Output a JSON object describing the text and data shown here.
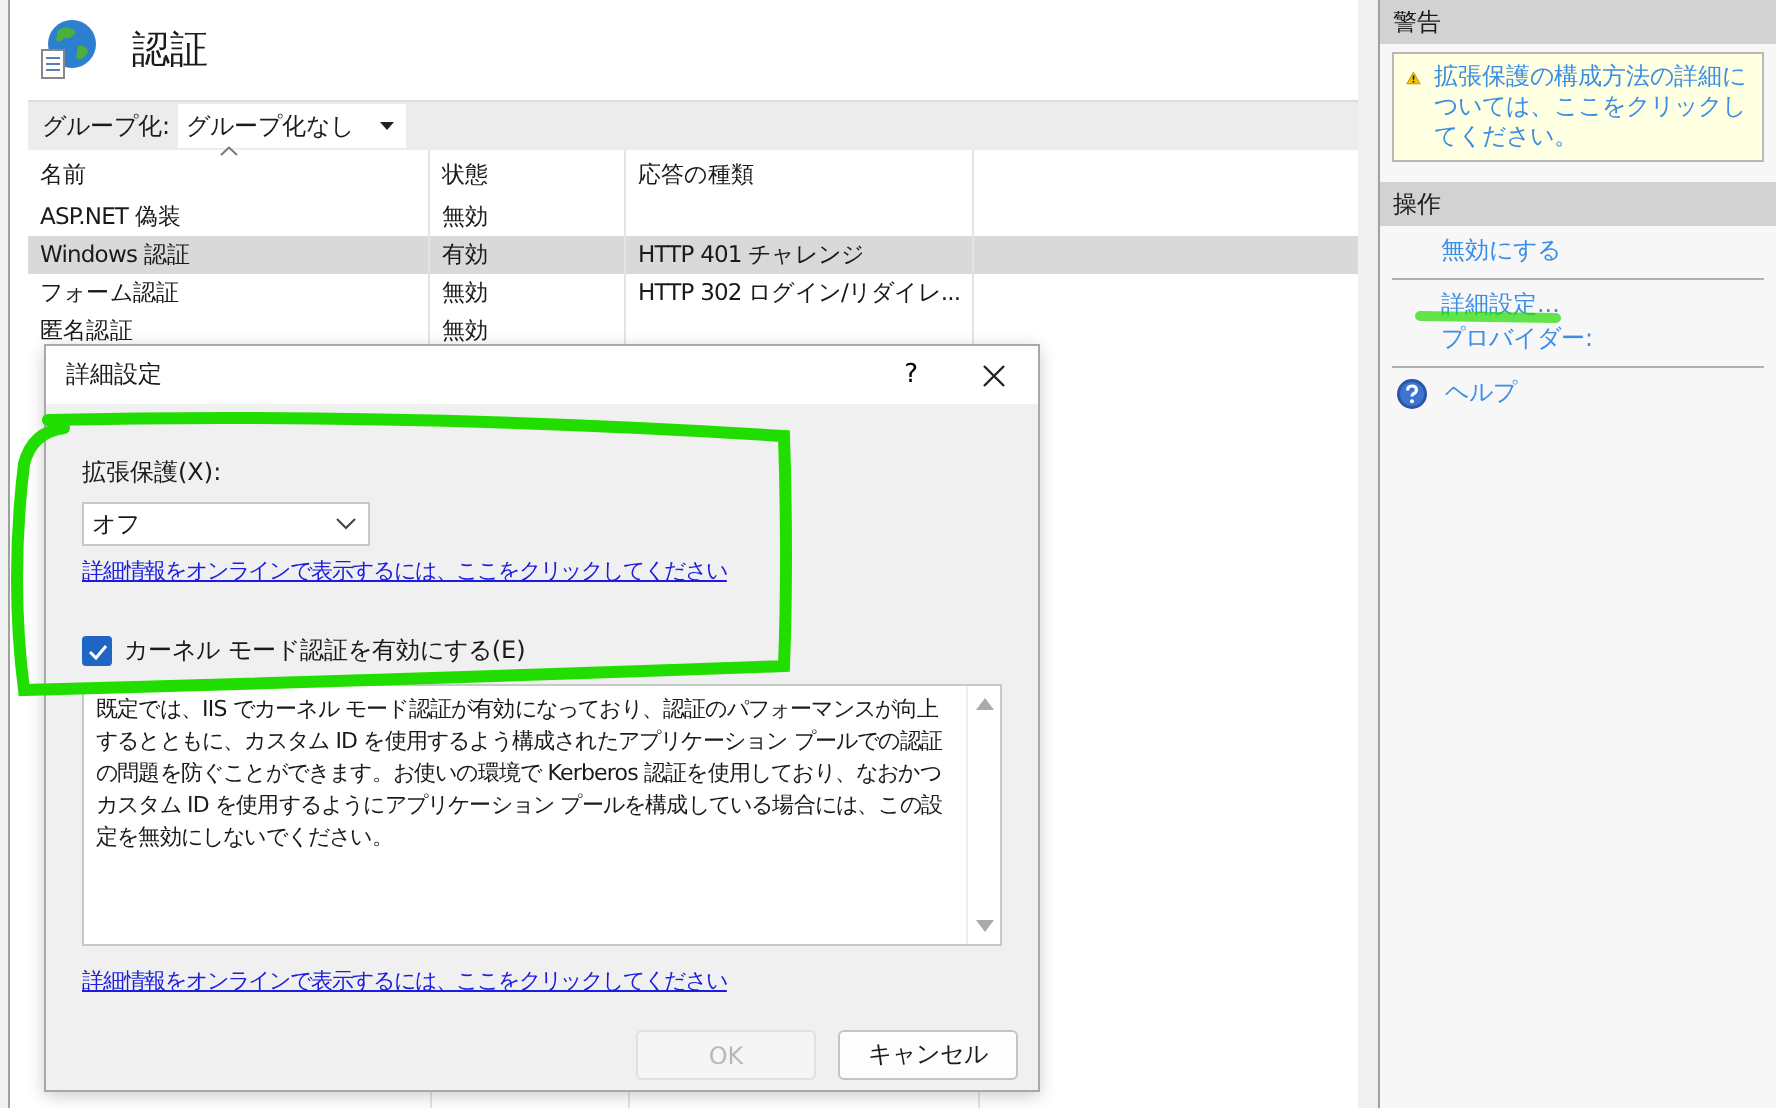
{
  "page": {
    "title": "認証"
  },
  "toolbar": {
    "label": "グループ化:",
    "group_by": "グループ化なし"
  },
  "table": {
    "columns": [
      {
        "label": "名前",
        "sorted": true
      },
      {
        "label": "状態",
        "sorted": false
      },
      {
        "label": "応答の種類",
        "sorted": false
      }
    ],
    "rows": [
      {
        "name": "ASP.NET 偽装",
        "state": "無効",
        "selected": false
      },
      {
        "name": "Windows 認証",
        "state": "有効",
        "response": "HTTP 401 チャレンジ",
        "selected": true
      },
      {
        "name": "フォーム認証",
        "state": "無効",
        "response": "HTTP 302 ログイン/リダイレ...",
        "selected": false
      },
      {
        "name": "匿名認証",
        "state": "無効",
        "selected": false
      }
    ]
  },
  "dialog": {
    "title": "詳細設定",
    "help": "?",
    "protection_label": "拡張保護(X):",
    "protection_value": "オフ",
    "link": "詳細情報をオンラインで表示するには、ここをクリックしてください",
    "kernel_mode": {
      "label": "カーネル モード認証を有効にする(E)",
      "checked": true
    },
    "description": "既定では、IIS でカーネル モード認証が有効になっており、認証のパフォーマンスが向上するとともに、カスタム ID を使用するよう構成されたアプリケーション プールでの認証の問題を防ぐことができます。お使いの環境で Kerberos 認証を使用しており、なおかつカスタム ID を使用するようにアプリケーション プールを構成している場合には、この設定を無効にしないでください。",
    "link_bottom": "詳細情報をオンラインで表示するには、ここをクリックしてください",
    "buttons": [
      {
        "label": "OK",
        "disabled": true
      },
      {
        "label": "キャンセル",
        "disabled": false
      }
    ]
  },
  "alerts": {
    "title": "警告",
    "message": "拡張保護の構成方法の詳細については、ここをクリックしてください。"
  },
  "actions": {
    "title": "操作",
    "groups": [
      {
        "items": [
          {
            "label": "無効にする",
            "kind": "link"
          }
        ]
      },
      {
        "items": [
          {
            "label": "詳細設定...",
            "kind": "link"
          },
          {
            "label": "プロバイダー:",
            "kind": "link"
          }
        ]
      },
      {
        "items": [
          {
            "label": "ヘルプ",
            "kind": "help"
          }
        ]
      }
    ]
  },
  "annotations": {
    "ring": true,
    "underline": true
  }
}
